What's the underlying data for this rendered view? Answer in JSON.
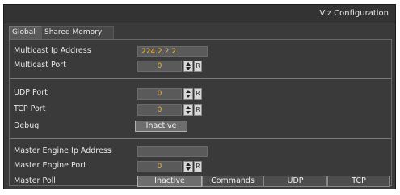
{
  "window": {
    "title": "Viz Configuration"
  },
  "tabs": [
    {
      "label": "Global",
      "active": true
    },
    {
      "label": "Shared Memory",
      "active": false
    }
  ],
  "fields": {
    "multicast_ip": {
      "label": "Multicast Ip Address",
      "value": "224.2.2.2"
    },
    "multicast_port": {
      "label": "Multicast Port",
      "value": "0"
    },
    "udp_port": {
      "label": "UDP Port",
      "value": "0"
    },
    "tcp_port": {
      "label": "TCP Port",
      "value": "0"
    },
    "debug": {
      "label": "Debug",
      "value": "Inactive"
    },
    "master_engine_ip": {
      "label": "Master Engine Ip Address",
      "value": ""
    },
    "master_engine_port": {
      "label": "Master Engine Port",
      "value": "0"
    },
    "master_poll": {
      "label": "Master Poll",
      "options": [
        "Inactive",
        "Commands",
        "UDP",
        "TCP"
      ],
      "selected": "Inactive"
    }
  },
  "spin_reset_glyph": "R",
  "colors": {
    "value_text": "#e6b84a",
    "panel_bg": "#3a3a3a"
  }
}
